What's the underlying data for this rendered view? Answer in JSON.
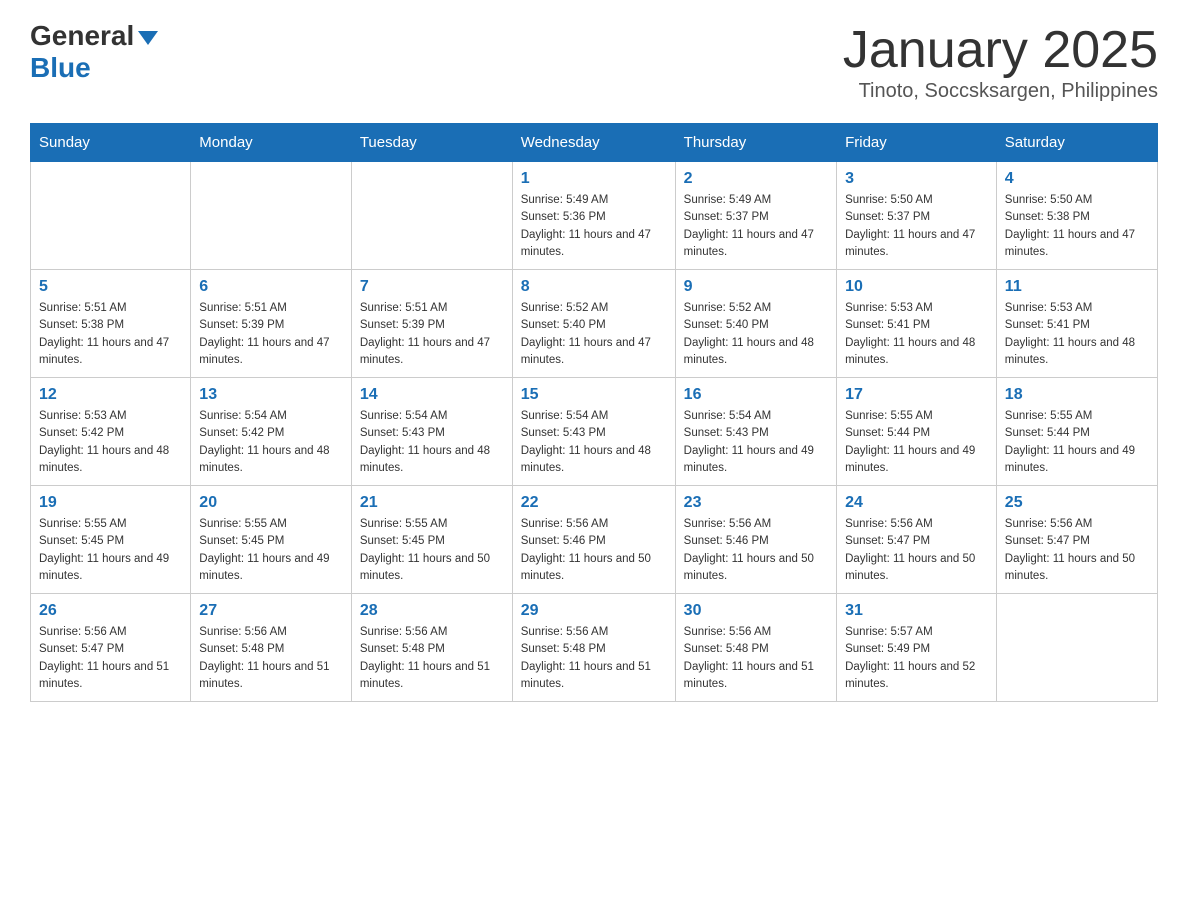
{
  "logo": {
    "general": "General",
    "blue": "Blue"
  },
  "title": "January 2025",
  "location": "Tinoto, Soccsksargen, Philippines",
  "days_of_week": [
    "Sunday",
    "Monday",
    "Tuesday",
    "Wednesday",
    "Thursday",
    "Friday",
    "Saturday"
  ],
  "weeks": [
    [
      {
        "day": "",
        "info": ""
      },
      {
        "day": "",
        "info": ""
      },
      {
        "day": "",
        "info": ""
      },
      {
        "day": "1",
        "info": "Sunrise: 5:49 AM\nSunset: 5:36 PM\nDaylight: 11 hours and 47 minutes."
      },
      {
        "day": "2",
        "info": "Sunrise: 5:49 AM\nSunset: 5:37 PM\nDaylight: 11 hours and 47 minutes."
      },
      {
        "day": "3",
        "info": "Sunrise: 5:50 AM\nSunset: 5:37 PM\nDaylight: 11 hours and 47 minutes."
      },
      {
        "day": "4",
        "info": "Sunrise: 5:50 AM\nSunset: 5:38 PM\nDaylight: 11 hours and 47 minutes."
      }
    ],
    [
      {
        "day": "5",
        "info": "Sunrise: 5:51 AM\nSunset: 5:38 PM\nDaylight: 11 hours and 47 minutes."
      },
      {
        "day": "6",
        "info": "Sunrise: 5:51 AM\nSunset: 5:39 PM\nDaylight: 11 hours and 47 minutes."
      },
      {
        "day": "7",
        "info": "Sunrise: 5:51 AM\nSunset: 5:39 PM\nDaylight: 11 hours and 47 minutes."
      },
      {
        "day": "8",
        "info": "Sunrise: 5:52 AM\nSunset: 5:40 PM\nDaylight: 11 hours and 47 minutes."
      },
      {
        "day": "9",
        "info": "Sunrise: 5:52 AM\nSunset: 5:40 PM\nDaylight: 11 hours and 48 minutes."
      },
      {
        "day": "10",
        "info": "Sunrise: 5:53 AM\nSunset: 5:41 PM\nDaylight: 11 hours and 48 minutes."
      },
      {
        "day": "11",
        "info": "Sunrise: 5:53 AM\nSunset: 5:41 PM\nDaylight: 11 hours and 48 minutes."
      }
    ],
    [
      {
        "day": "12",
        "info": "Sunrise: 5:53 AM\nSunset: 5:42 PM\nDaylight: 11 hours and 48 minutes."
      },
      {
        "day": "13",
        "info": "Sunrise: 5:54 AM\nSunset: 5:42 PM\nDaylight: 11 hours and 48 minutes."
      },
      {
        "day": "14",
        "info": "Sunrise: 5:54 AM\nSunset: 5:43 PM\nDaylight: 11 hours and 48 minutes."
      },
      {
        "day": "15",
        "info": "Sunrise: 5:54 AM\nSunset: 5:43 PM\nDaylight: 11 hours and 48 minutes."
      },
      {
        "day": "16",
        "info": "Sunrise: 5:54 AM\nSunset: 5:43 PM\nDaylight: 11 hours and 49 minutes."
      },
      {
        "day": "17",
        "info": "Sunrise: 5:55 AM\nSunset: 5:44 PM\nDaylight: 11 hours and 49 minutes."
      },
      {
        "day": "18",
        "info": "Sunrise: 5:55 AM\nSunset: 5:44 PM\nDaylight: 11 hours and 49 minutes."
      }
    ],
    [
      {
        "day": "19",
        "info": "Sunrise: 5:55 AM\nSunset: 5:45 PM\nDaylight: 11 hours and 49 minutes."
      },
      {
        "day": "20",
        "info": "Sunrise: 5:55 AM\nSunset: 5:45 PM\nDaylight: 11 hours and 49 minutes."
      },
      {
        "day": "21",
        "info": "Sunrise: 5:55 AM\nSunset: 5:45 PM\nDaylight: 11 hours and 50 minutes."
      },
      {
        "day": "22",
        "info": "Sunrise: 5:56 AM\nSunset: 5:46 PM\nDaylight: 11 hours and 50 minutes."
      },
      {
        "day": "23",
        "info": "Sunrise: 5:56 AM\nSunset: 5:46 PM\nDaylight: 11 hours and 50 minutes."
      },
      {
        "day": "24",
        "info": "Sunrise: 5:56 AM\nSunset: 5:47 PM\nDaylight: 11 hours and 50 minutes."
      },
      {
        "day": "25",
        "info": "Sunrise: 5:56 AM\nSunset: 5:47 PM\nDaylight: 11 hours and 50 minutes."
      }
    ],
    [
      {
        "day": "26",
        "info": "Sunrise: 5:56 AM\nSunset: 5:47 PM\nDaylight: 11 hours and 51 minutes."
      },
      {
        "day": "27",
        "info": "Sunrise: 5:56 AM\nSunset: 5:48 PM\nDaylight: 11 hours and 51 minutes."
      },
      {
        "day": "28",
        "info": "Sunrise: 5:56 AM\nSunset: 5:48 PM\nDaylight: 11 hours and 51 minutes."
      },
      {
        "day": "29",
        "info": "Sunrise: 5:56 AM\nSunset: 5:48 PM\nDaylight: 11 hours and 51 minutes."
      },
      {
        "day": "30",
        "info": "Sunrise: 5:56 AM\nSunset: 5:48 PM\nDaylight: 11 hours and 51 minutes."
      },
      {
        "day": "31",
        "info": "Sunrise: 5:57 AM\nSunset: 5:49 PM\nDaylight: 11 hours and 52 minutes."
      },
      {
        "day": "",
        "info": ""
      }
    ]
  ]
}
